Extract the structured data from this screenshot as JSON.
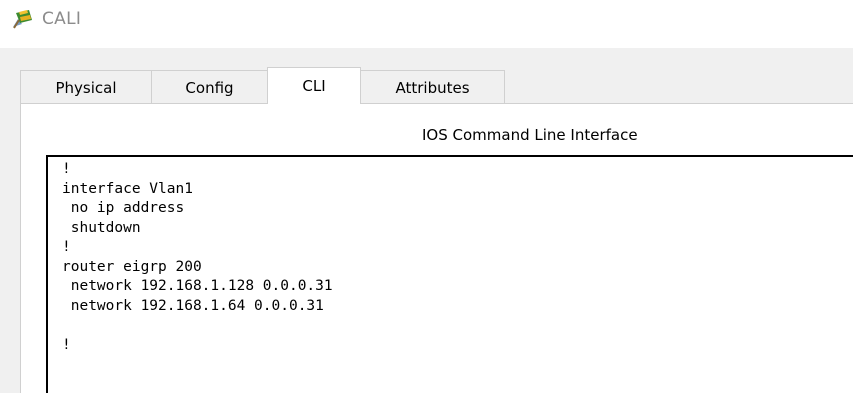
{
  "window": {
    "title": "CALI",
    "icon": "router-device-icon"
  },
  "tabs": [
    {
      "label": "Physical",
      "active": false
    },
    {
      "label": "Config",
      "active": false
    },
    {
      "label": "CLI",
      "active": true
    },
    {
      "label": "Attributes",
      "active": false
    }
  ],
  "cli": {
    "heading": "IOS Command Line Interface",
    "lines": [
      "!",
      "interface Vlan1",
      " no ip address",
      " shutdown",
      "!",
      "router eigrp 200",
      " network 192.168.1.128 0.0.0.31",
      " network 192.168.1.64 0.0.0.31",
      "",
      "!"
    ]
  }
}
